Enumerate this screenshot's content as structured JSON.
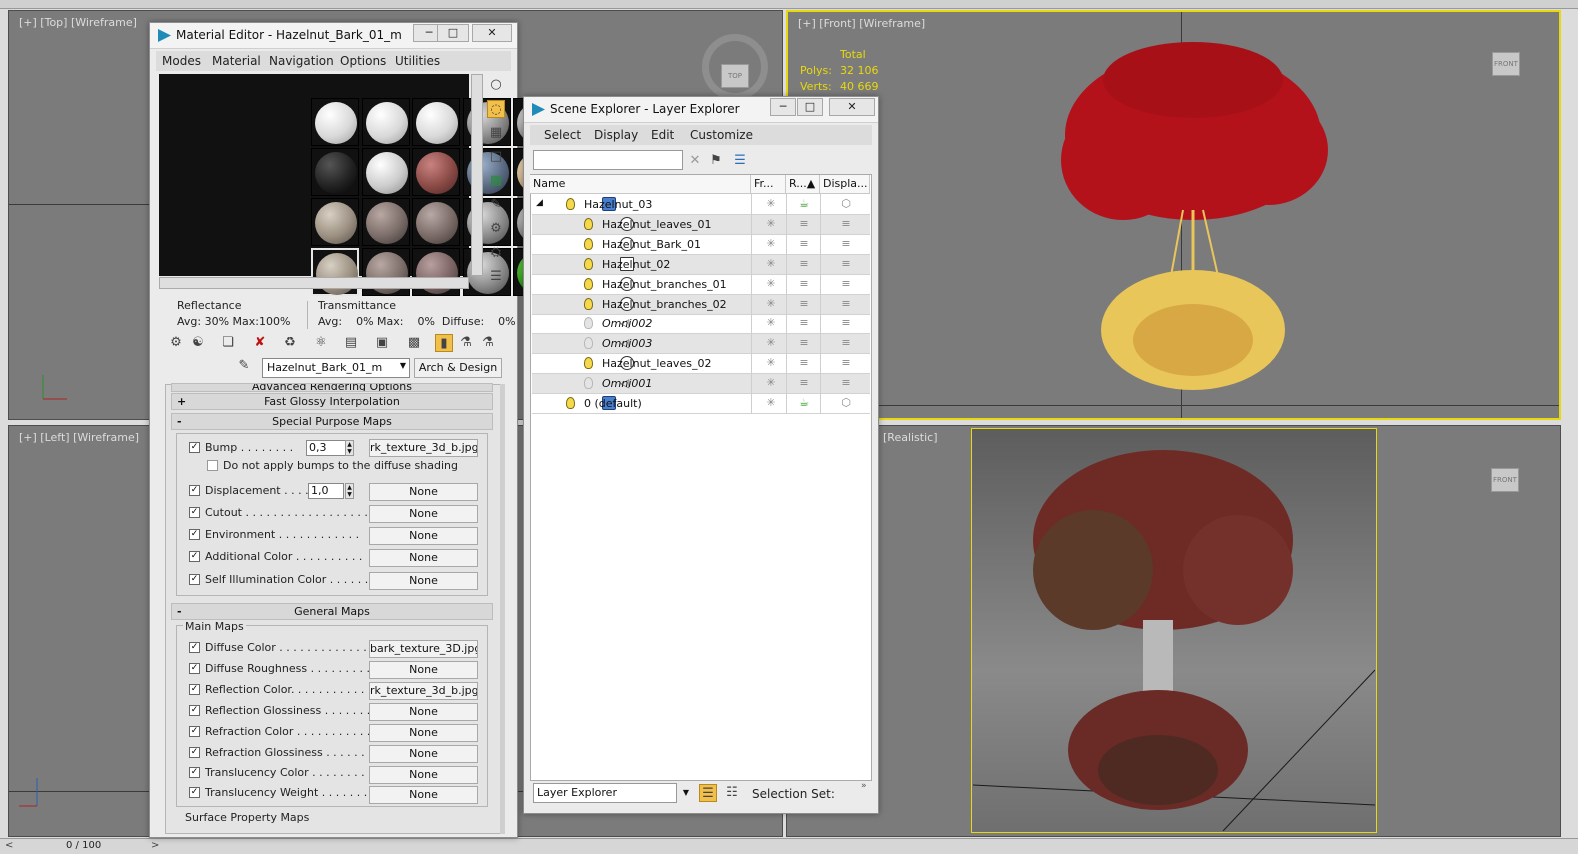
{
  "viewports": {
    "top": {
      "label": "[+] [Top] [Wireframe]"
    },
    "front": {
      "label": "[+] [Front] [Wireframe]",
      "stats": {
        "title": "Total",
        "polys_label": "Polys:",
        "polys": "32 106",
        "verts_label": "Verts:",
        "verts": "40 669"
      },
      "cube": "FRONT"
    },
    "left": {
      "label": "[+] [Left] [Wireframe]"
    },
    "persp": {
      "label": "[Realistic]",
      "cube": "FRONT"
    },
    "top_cube": "TOP"
  },
  "timeline": {
    "frame": "0 / 100"
  },
  "material_editor": {
    "title": "Material Editor - Hazelnut_Bark_01_m",
    "menu": [
      "Modes",
      "Material",
      "Navigation",
      "Options",
      "Utilities"
    ],
    "reflectance_label": "Reflectance",
    "reflectance_value": "Avg: 30% Max:100%",
    "transmittance_label": "Transmittance",
    "transmittance_value": "Avg:    0% Max:    0%  Diffuse:    0%",
    "material_name": "Hazelnut_Bark_01_m",
    "material_type": "Arch & Design",
    "rollouts": {
      "advanced": "Advanced Rendering Options",
      "fast_glossy": "Fast Glossy Interpolation",
      "special_maps": "Special Purpose Maps",
      "general_maps": "General Maps",
      "main_maps": "Main Maps",
      "surface_maps": "Surface Property Maps"
    },
    "special": [
      {
        "label": "Bump . . . . . . . .",
        "spinner": "0,3",
        "map": "rk_texture_3d_b.jpg)"
      },
      {
        "label": "Do not apply bumps to the diffuse shading"
      },
      {
        "label": "Displacement . . . .",
        "spinner": "1,0",
        "map": "None"
      },
      {
        "label": "Cutout . . . . . . . . . . . . . . . . . . .",
        "map": "None"
      },
      {
        "label": "Environment . . . . . . . . . . . .",
        "map": "None"
      },
      {
        "label": "Additional Color . . . . . . . . . .",
        "map": "None"
      },
      {
        "label": "Self Illumination Color . . . . . .",
        "map": "None"
      }
    ],
    "general": [
      {
        "label": "Diffuse Color . . . . . . . . . . . . .",
        "map": "bark_texture_3D.jpg)"
      },
      {
        "label": "Diffuse Roughness . . . . . . . . .",
        "map": "None"
      },
      {
        "label": "Reflection Color. . . . . . . . . . . .",
        "map": "rk_texture_3d_b.jpg)"
      },
      {
        "label": "Reflection Glossiness . . . . . . . .",
        "map": "None"
      },
      {
        "label": "Refraction Color . . . . . . . . . . .",
        "map": "None"
      },
      {
        "label": "Refraction Glossiness . . . . . . .",
        "map": "None"
      },
      {
        "label": "Translucency Color . . . . . . . . .",
        "map": "None"
      },
      {
        "label": "Translucency Weight . . . . . . . .",
        "map": "None"
      }
    ]
  },
  "scene_explorer": {
    "title": "Scene Explorer - Layer Explorer",
    "menu": [
      "Select",
      "Display",
      "Edit",
      "Customize"
    ],
    "columns": [
      "Name",
      "Fr...",
      "R...▲",
      "Displa..."
    ],
    "rows": [
      {
        "name": "Hazelnut_03"
      },
      {
        "name": "Hazelnut_leaves_01"
      },
      {
        "name": "Hazelnut_Bark_01"
      },
      {
        "name": "Hazelnut_02"
      },
      {
        "name": "Hazelnut_branches_01"
      },
      {
        "name": "Hazelnut_branches_02"
      },
      {
        "name": "Omni002"
      },
      {
        "name": "Omni003"
      },
      {
        "name": "Hazelnut_leaves_02"
      },
      {
        "name": "Omni001"
      },
      {
        "name": "0 (default)"
      }
    ],
    "explorer_select": "Layer Explorer",
    "selection_set_label": "Selection Set:"
  },
  "colors": {
    "accent": "#e8d90d",
    "viewport_bg": "#7b7b7b",
    "wire_red": "#b3121b",
    "wire_yellow": "#e8c65a"
  }
}
